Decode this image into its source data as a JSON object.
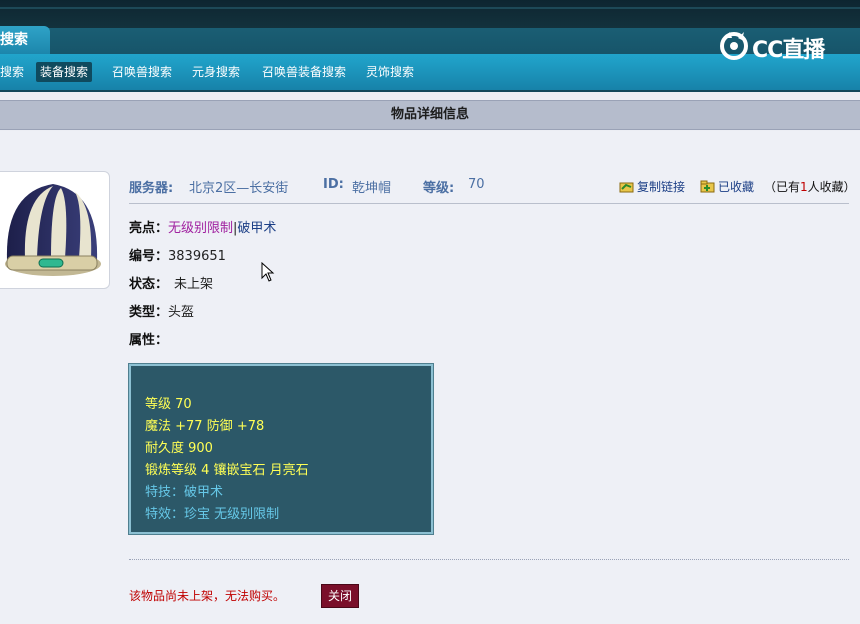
{
  "header": {
    "main_tab": "搜索",
    "nav": [
      {
        "label": "搜索"
      },
      {
        "label": "装备搜索"
      },
      {
        "label": "召唤兽搜索"
      },
      {
        "label": "元身搜索"
      },
      {
        "label": "召唤兽装备搜索"
      },
      {
        "label": "灵饰搜索"
      }
    ],
    "logo_text": "CC直播"
  },
  "title": "物品详细信息",
  "info": {
    "server_label": "服务器:",
    "server_value": "北京2区—长安街",
    "id_label": "ID:",
    "id_value": "乾坤帽",
    "level_label": "等级:",
    "level_value": "70",
    "copy_link": "复制链接",
    "favorited": "已收藏",
    "fav_prefix": "（已有",
    "fav_count": "1",
    "fav_suffix": "人收藏）"
  },
  "details": {
    "highlight_label": "亮点：",
    "highlight_a": "无级别限制",
    "highlight_sep": "|",
    "highlight_b": "破甲术",
    "number_label": "编号：",
    "number_value": "3839651",
    "status_label": "状态：",
    "status_value": "未上架",
    "type_label": "类型：",
    "type_value": "头盔",
    "attr_label": "属性："
  },
  "attributes": {
    "line1": "等级 70",
    "line2": "魔法 +77 防御 +78",
    "line3": "耐久度 900",
    "line4": "锻炼等级 4 镶嵌宝石 月亮石",
    "line5": "特技：破甲术",
    "line6": "特效：珍宝 无级别限制"
  },
  "footer": {
    "warning": "该物品尚未上架，无法购买。",
    "close_label": "关闭"
  },
  "colors": {
    "accent": "#1c86ac",
    "attr_bg": "#2c5868",
    "warning": "#c00000",
    "close_button": "#7a0f2a"
  }
}
